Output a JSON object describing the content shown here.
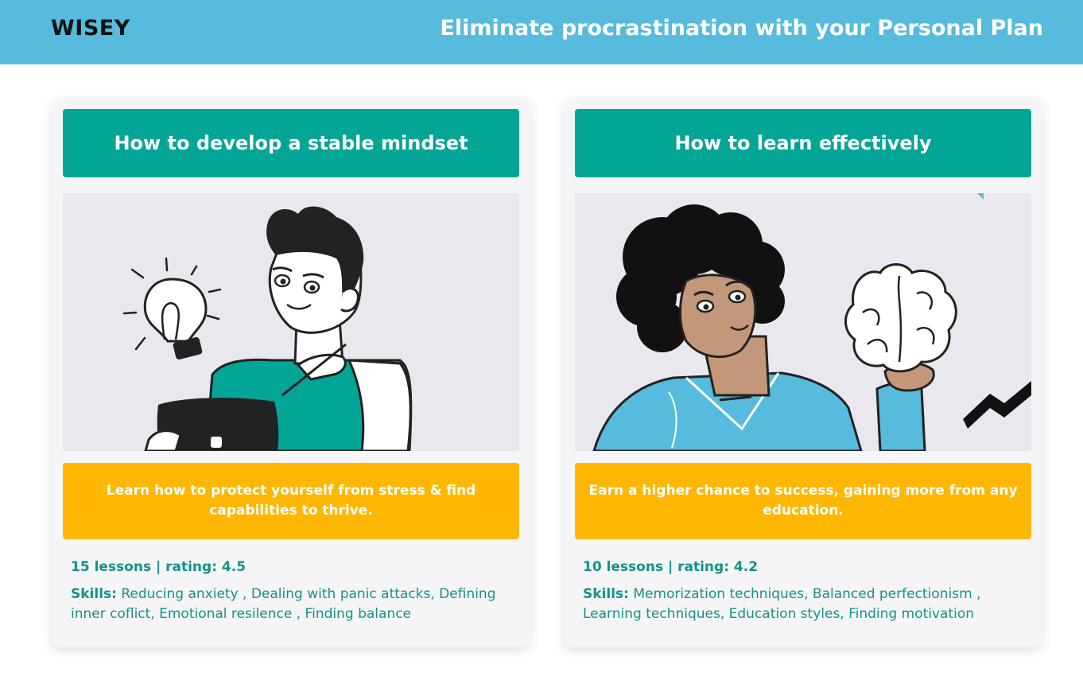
{
  "header": {
    "logo": "WISEY",
    "headline": "Eliminate procrastination with your Personal Plan"
  },
  "colors": {
    "header_bg": "#56bbdd",
    "title_bg": "#03a597",
    "desc_bg": "#ffb703",
    "text_teal": "#14928a",
    "card_bg": "#f5f5f7"
  },
  "cards": [
    {
      "title": "How to develop a stable mindset",
      "image": "man-with-lightbulb-illustration",
      "description": "Learn how to protect yourself from stress & find capabilities to thrive.",
      "meta": "15 lessons | rating: 4.5",
      "skills_label": "Skills:",
      "skills": "Reducing anxiety , Dealing with panic attacks, Defining inner coflict, Emotional resilence , Finding balance"
    },
    {
      "title": "How to learn effectively",
      "image": "woman-holding-brain-illustration",
      "description": "Earn a higher chance to success, gaining more from any education.",
      "meta": "10 lessons | rating: 4.2",
      "skills_label": "Skills:",
      "skills": "Memorization techniques, Balanced perfectionism , Learning techniques, Education styles, Finding motivation"
    }
  ]
}
